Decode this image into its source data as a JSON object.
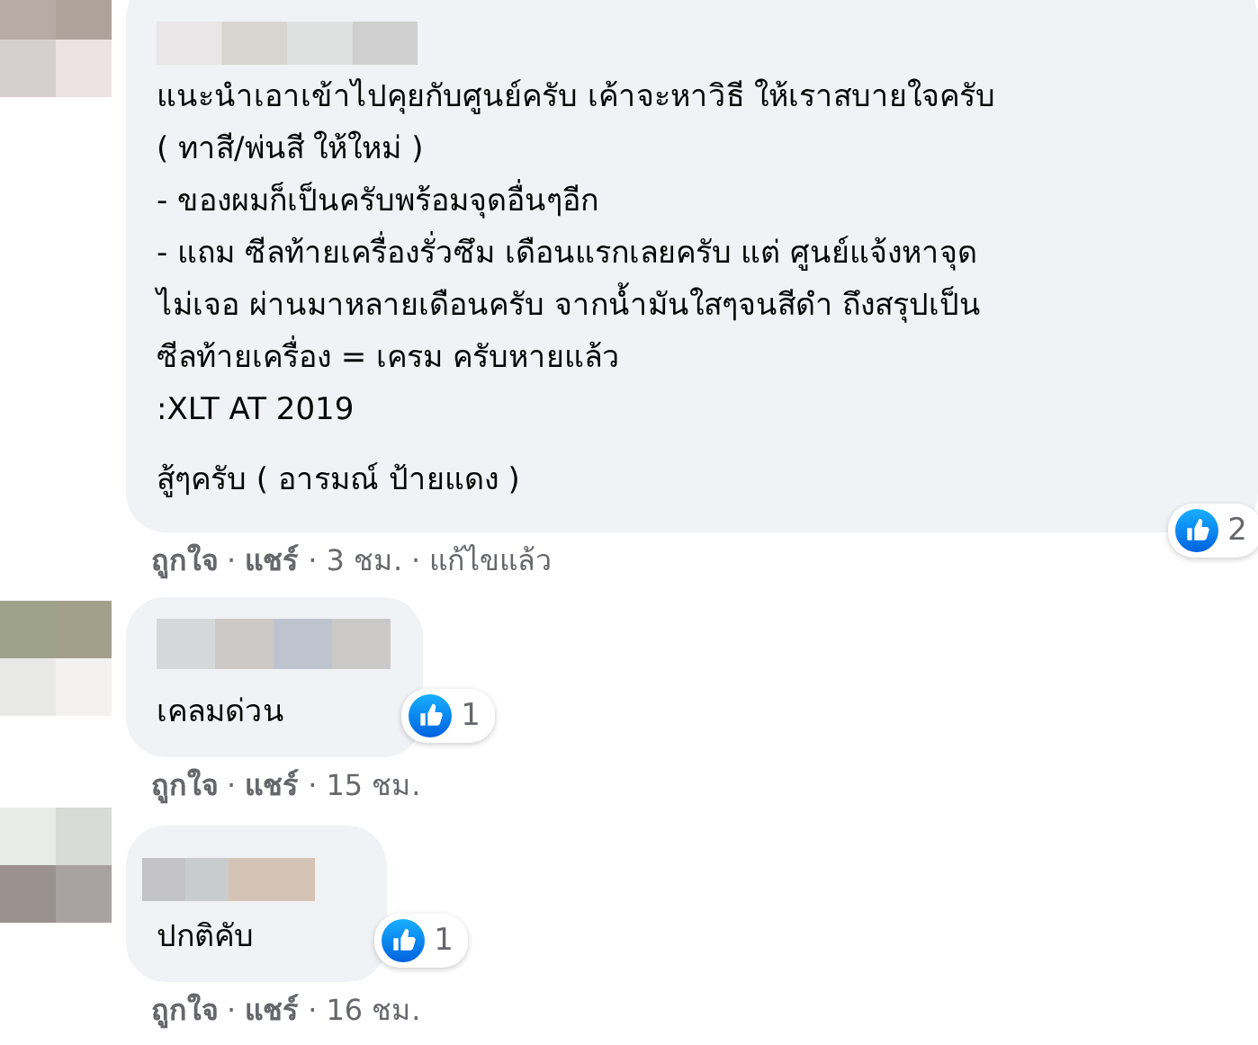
{
  "comments": [
    {
      "text": "แนะนำเอาเข้าไปคุยกับศูนย์ครับ เค้าจะหาวิธี ให้เราสบายใจครับ\n( ทาสี/พ่นสี ให้ใหม่ )\n- ของผมก็เป็นครับพร้อมจุดอื่นๆอีก\n- แถม ซีลท้ายเครื่องรั่วซึม เดือนแรกเลยครับ แต่ ศูนย์แจ้งหาจุด\nไม่เจอ ผ่านมาหลายเดือนครับ จากน้ำมันใสๆจนสีดำ ถึงสรุปเป็น\nซีลท้ายเครื่อง = เครม ครับหายแล้ว\n:XLT AT 2019",
      "extra": "สู้ๆครับ ( อารมณ์ ป้ายแดง )",
      "reactions": "2",
      "separator": "·",
      "like": "ถูกใจ",
      "share": "แชร์",
      "time": "3 ชม.",
      "edited": "แก้ไขแล้ว"
    },
    {
      "text": "เคลมด่วน",
      "reactions": "1",
      "separator": "·",
      "like": "ถูกใจ",
      "share": "แชร์",
      "time": "15 ชม."
    },
    {
      "text": "ปกติคับ",
      "reactions": "1",
      "separator": "·",
      "like": "ถูกใจ",
      "share": "แชร์",
      "time": "16 ชม."
    }
  ]
}
